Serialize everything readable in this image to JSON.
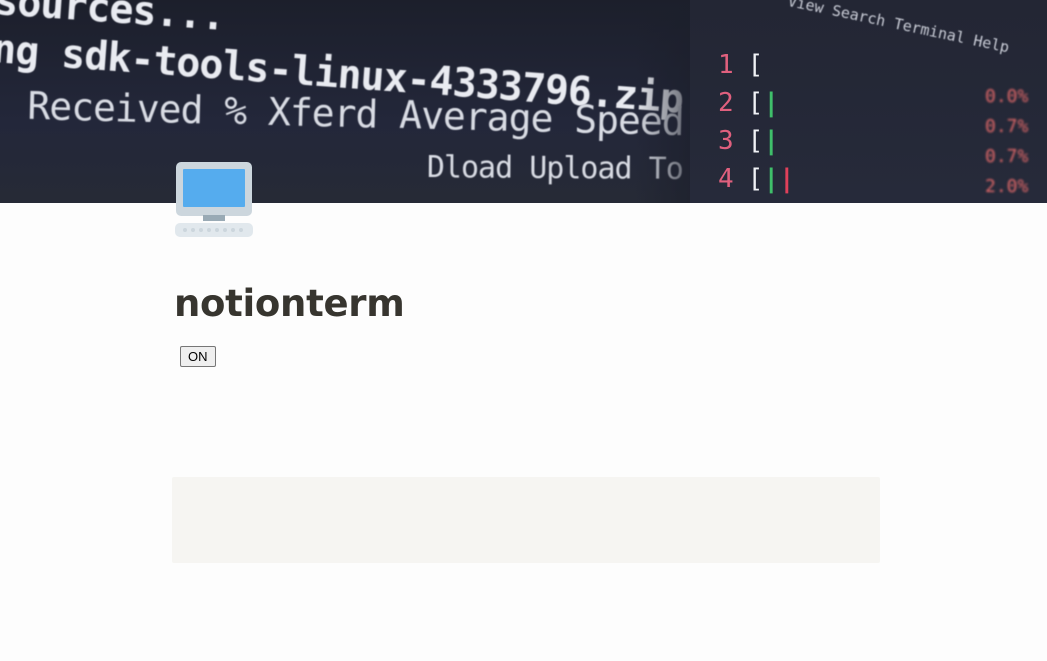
{
  "cover": {
    "terminal_lines": [
      "sources...",
      "ng sdk-tools-linux-4333796.zip...",
      "Received % Xferd  Average Speed  Ti",
      "Dload  Upload  To"
    ],
    "menu_text": "View  Search  Terminal  Help",
    "cpu_rows": [
      {
        "n": "1",
        "bracket": "["
      },
      {
        "n": "2",
        "bracket": "["
      },
      {
        "n": "3",
        "bracket": "["
      },
      {
        "n": "4",
        "bracket": "["
      }
    ],
    "percentages": [
      "0.0%",
      "0.7%",
      "0.7%",
      "2.0%"
    ]
  },
  "page": {
    "icon": "desktop-computer-icon",
    "title": "notionterm",
    "toggle_label": "ON"
  },
  "colors": {
    "title": "#37352f",
    "block_background": "#f6f5f2",
    "page_background": "#fdfdfd"
  }
}
